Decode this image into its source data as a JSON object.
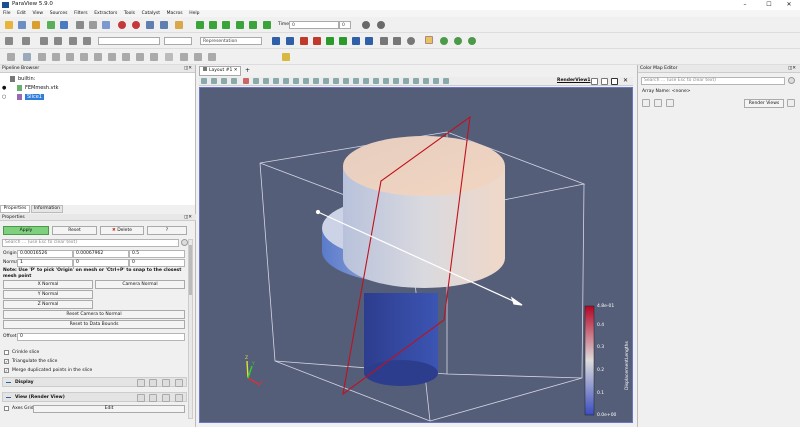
{
  "app": {
    "title": "ParaView 5.9.0"
  },
  "menu": [
    "File",
    "Edit",
    "View",
    "Sources",
    "Filters",
    "Extractors",
    "Tools",
    "Catalyst",
    "Macros",
    "Help"
  ],
  "toolbar": {
    "time_label": "Time:",
    "time_value": "0",
    "time_index": "0",
    "representation": "Representation"
  },
  "pipeline": {
    "title": "Pipeline Browser",
    "items": [
      {
        "label": "builtin:"
      },
      {
        "label": "FEMmesh.vtk"
      },
      {
        "label": "Slice1"
      }
    ]
  },
  "properties": {
    "tabs": [
      "Properties",
      "Information"
    ],
    "title": "Properties",
    "apply": "Apply",
    "reset": "Reset",
    "delete": "Delete",
    "help": "?",
    "search_placeholder": "Search ... (use Esc to clear text)",
    "origin_label": "Origin",
    "origin": [
      "0.00016526",
      "0.00067962",
      "0.5"
    ],
    "normal_label": "Normal",
    "normal": [
      "1",
      "0",
      "0"
    ],
    "note": "Note: Use 'P' to pick 'Origin' on mesh or 'Ctrl+P' to snap to the closest mesh point",
    "x_normal": "X Normal",
    "camera_normal": "Camera Normal",
    "y_normal": "Y Normal",
    "z_normal": "Z Normal",
    "reset_camera_normal": "Reset Camera to Normal",
    "reset_bounds": "Reset to Data Bounds",
    "offset_label": "Offset",
    "offset": "0",
    "crinkle": "Crinkle slice",
    "triangulate": "Triangulate the slice",
    "merge": "Merge duplicated points in the slice",
    "display_section": "Display",
    "view_section": "View (Render View)",
    "axes_grid": "Axes Grid",
    "edit": "Edit"
  },
  "layout": {
    "tab": "Layout #1",
    "view_label": "RenderView1"
  },
  "colorbar": {
    "title": "DisplacementLengths",
    "ticks": [
      "4.8e-01",
      "0.4",
      "0.3",
      "0.2",
      "0.1",
      "0.0e+00"
    ]
  },
  "colormap": {
    "title": "Color Map Editor",
    "search_placeholder": "Search ... (use Esc to clear text)",
    "array_name": "Array Name: <none>",
    "render_views": "Render Views"
  },
  "axes": {
    "x": "X",
    "y": "Y",
    "z": "Z"
  }
}
